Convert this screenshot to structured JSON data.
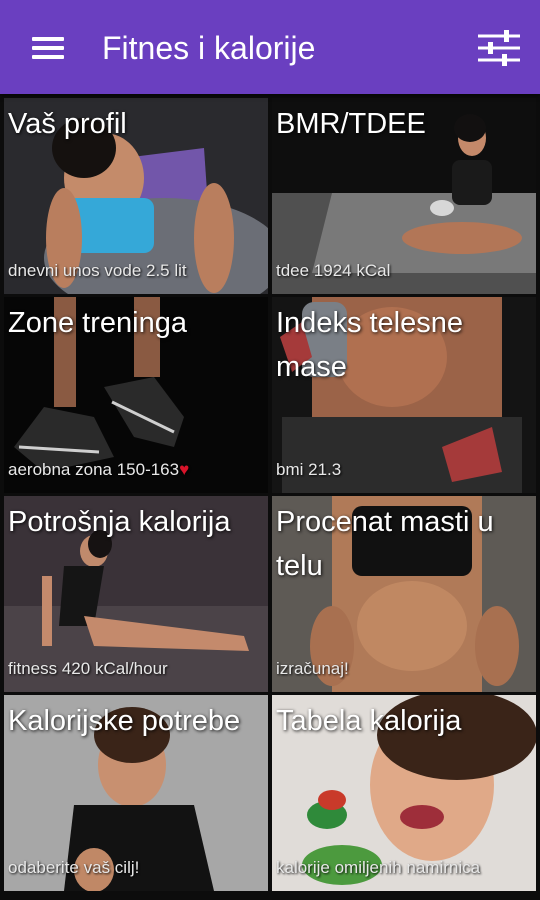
{
  "app": {
    "title": "Fitnes i kalorije",
    "colors": {
      "appbar": "#6a3fc0",
      "accent_heart": "#d8142a"
    },
    "icons": {
      "menu": "hamburger-icon",
      "settings": "sliders-icon"
    }
  },
  "tiles": [
    {
      "title": "Vaš profil",
      "subtitle": "dnevni unos vode 2.5 lit"
    },
    {
      "title": "BMR/TDEE",
      "subtitle": "tdee 1924 kCal"
    },
    {
      "title": "Zone treninga",
      "subtitle": "aerobna zona 150-163",
      "subtitle_icon": "♥"
    },
    {
      "title": "Indeks telesne mase",
      "subtitle": "bmi 21.3"
    },
    {
      "title": "Potrošnja kalorija",
      "subtitle": "fitness 420 kCal/hour"
    },
    {
      "title": "Procenat masti u telu",
      "subtitle": "izračunaj!"
    },
    {
      "title": "Kalorijske potrebe",
      "subtitle": "odaberite vaš cilj!"
    },
    {
      "title": "Tabela kalorija",
      "subtitle": "kalorije omiljenih namirnica"
    }
  ]
}
